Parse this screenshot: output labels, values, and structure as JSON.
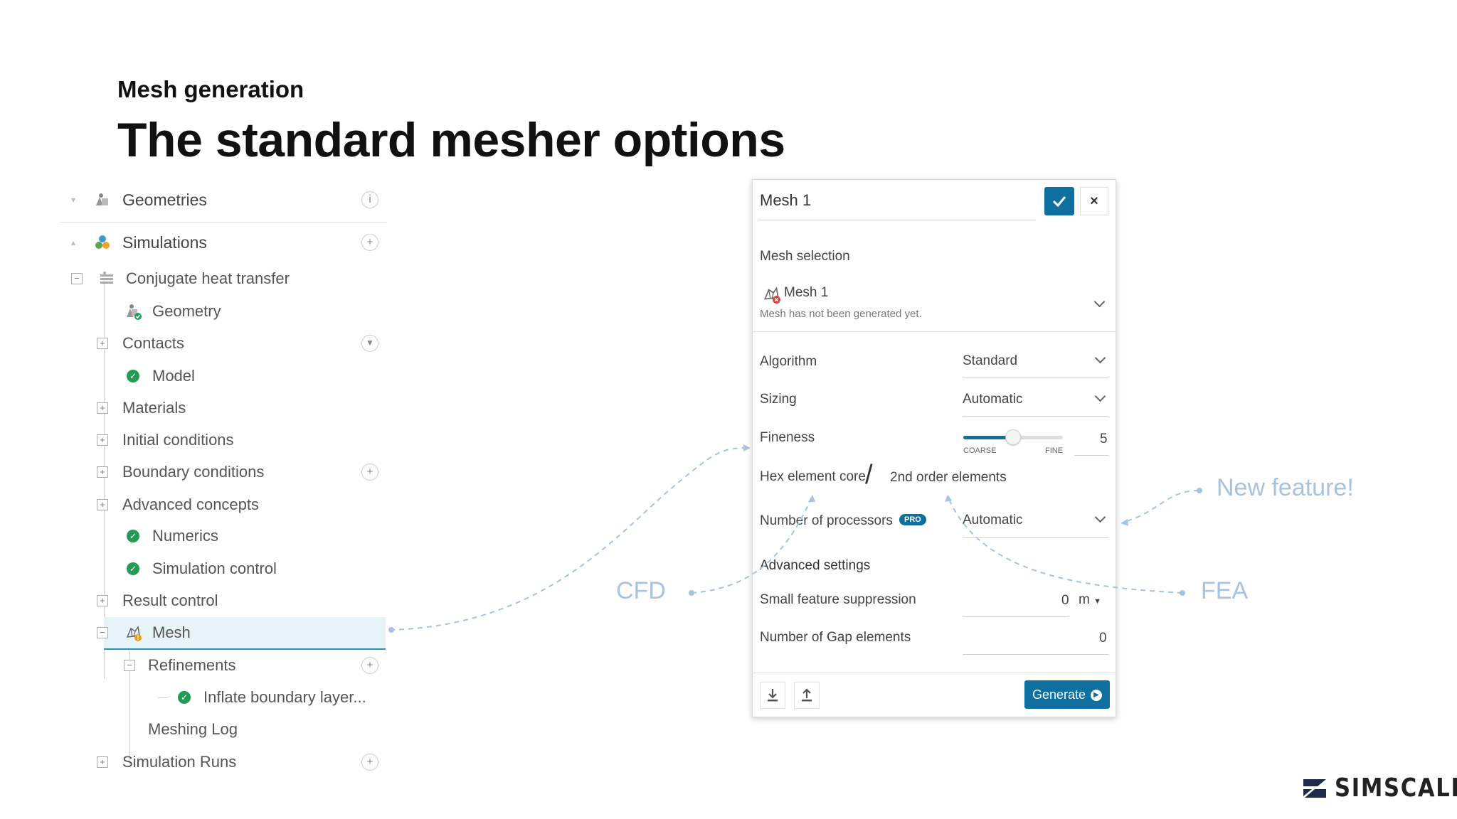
{
  "header": {
    "subtitle": "Mesh generation",
    "title": "The standard mesher options"
  },
  "tree": {
    "geometries": "Geometries",
    "simulations": "Simulations",
    "simulation_name": "Conjugate heat transfer",
    "geometry": "Geometry",
    "contacts": "Contacts",
    "model": "Model",
    "materials": "Materials",
    "initial_conditions": "Initial conditions",
    "boundary_conditions": "Boundary conditions",
    "advanced_concepts": "Advanced concepts",
    "numerics": "Numerics",
    "simulation_control": "Simulation control",
    "result_control": "Result control",
    "mesh": "Mesh",
    "refinements": "Refinements",
    "inflate_boundary_layer": "Inflate boundary layer...",
    "meshing_log": "Meshing Log",
    "simulation_runs": "Simulation Runs"
  },
  "dialog": {
    "name_value": "Mesh 1",
    "mesh_selection_label": "Mesh selection",
    "mesh_selected": "Mesh 1",
    "mesh_status": "Mesh has not been generated yet.",
    "algorithm_label": "Algorithm",
    "algorithm_value": "Standard",
    "sizing_label": "Sizing",
    "sizing_value": "Automatic",
    "fineness_label": "Fineness",
    "fineness_value": "5",
    "fineness_fraction": 0.5,
    "coarse_label": "COARSE",
    "fine_label": "FINE",
    "hex_label": "Hex element core",
    "slash": "/",
    "second_order_label": "2nd order elements",
    "processors_label": "Number of processors",
    "pro_badge": "PRO",
    "processors_value": "Automatic",
    "advanced_settings": "Advanced settings",
    "small_feature_label": "Small feature suppression",
    "small_feature_value": "0",
    "small_feature_unit": "m",
    "gap_elements_label": "Number of Gap elements",
    "gap_elements_value": "0",
    "generate_label": "Generate"
  },
  "annotations": {
    "new_feature": "New feature!",
    "cfd": "CFD",
    "fea": "FEA"
  },
  "logo": {
    "text": "SIMSCALE"
  },
  "colors": {
    "accent": "#0e6fa1",
    "success": "#219b55",
    "annotation": "#a7c3e2",
    "selection": "#e6f3f8"
  }
}
